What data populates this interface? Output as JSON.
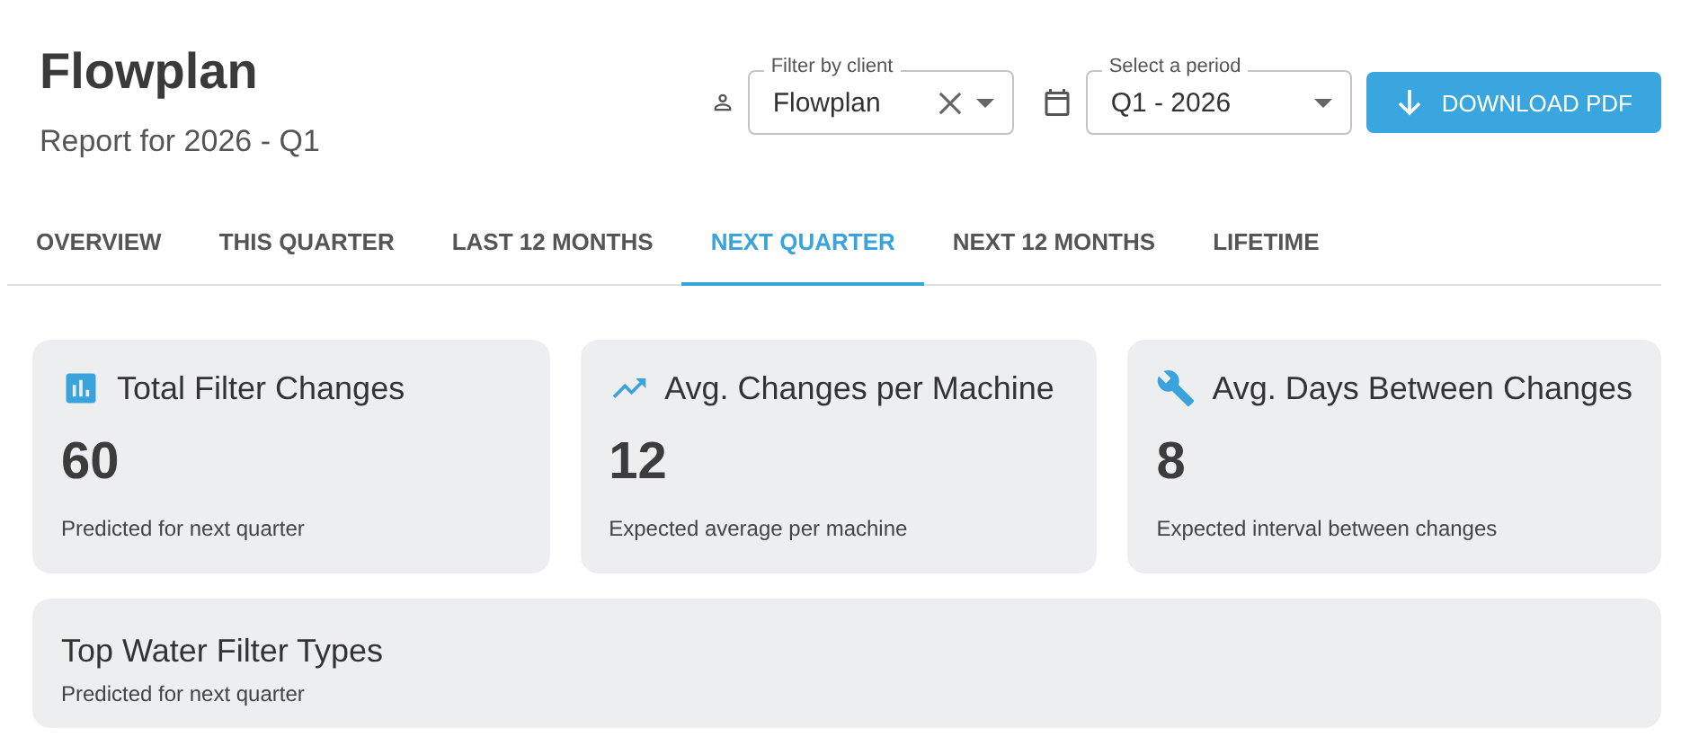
{
  "header": {
    "title": "Flowplan",
    "subtitle": "Report for 2026 - Q1"
  },
  "filters": [
    {
      "kind": "client",
      "label": "Filter by client",
      "value": "Flowplan",
      "clearable": true
    },
    {
      "kind": "period",
      "label": "Select a period",
      "value": "Q1 - 2026",
      "clearable": false
    }
  ],
  "download_button": "DOWNLOAD PDF",
  "tabs": [
    {
      "label": "OVERVIEW",
      "selected": false
    },
    {
      "label": "THIS QUARTER",
      "selected": false
    },
    {
      "label": "LAST 12 MONTHS",
      "selected": false
    },
    {
      "label": "NEXT QUARTER",
      "selected": true
    },
    {
      "label": "NEXT 12 MONTHS",
      "selected": false
    },
    {
      "label": "LIFETIME",
      "selected": false
    }
  ],
  "stats": [
    {
      "kind": "bars",
      "title": "Total Filter Changes",
      "value": "60",
      "caption": "Predicted for next quarter"
    },
    {
      "kind": "trend",
      "title": "Avg. Changes per Machine",
      "value": "12",
      "caption": "Expected average per machine"
    },
    {
      "kind": "wrench",
      "title": "Avg. Days Between Changes",
      "value": "8",
      "caption": "Expected interval between changes"
    }
  ],
  "top_types": {
    "title": "Top Water Filter Types",
    "caption": "Predicted for next quarter"
  }
}
